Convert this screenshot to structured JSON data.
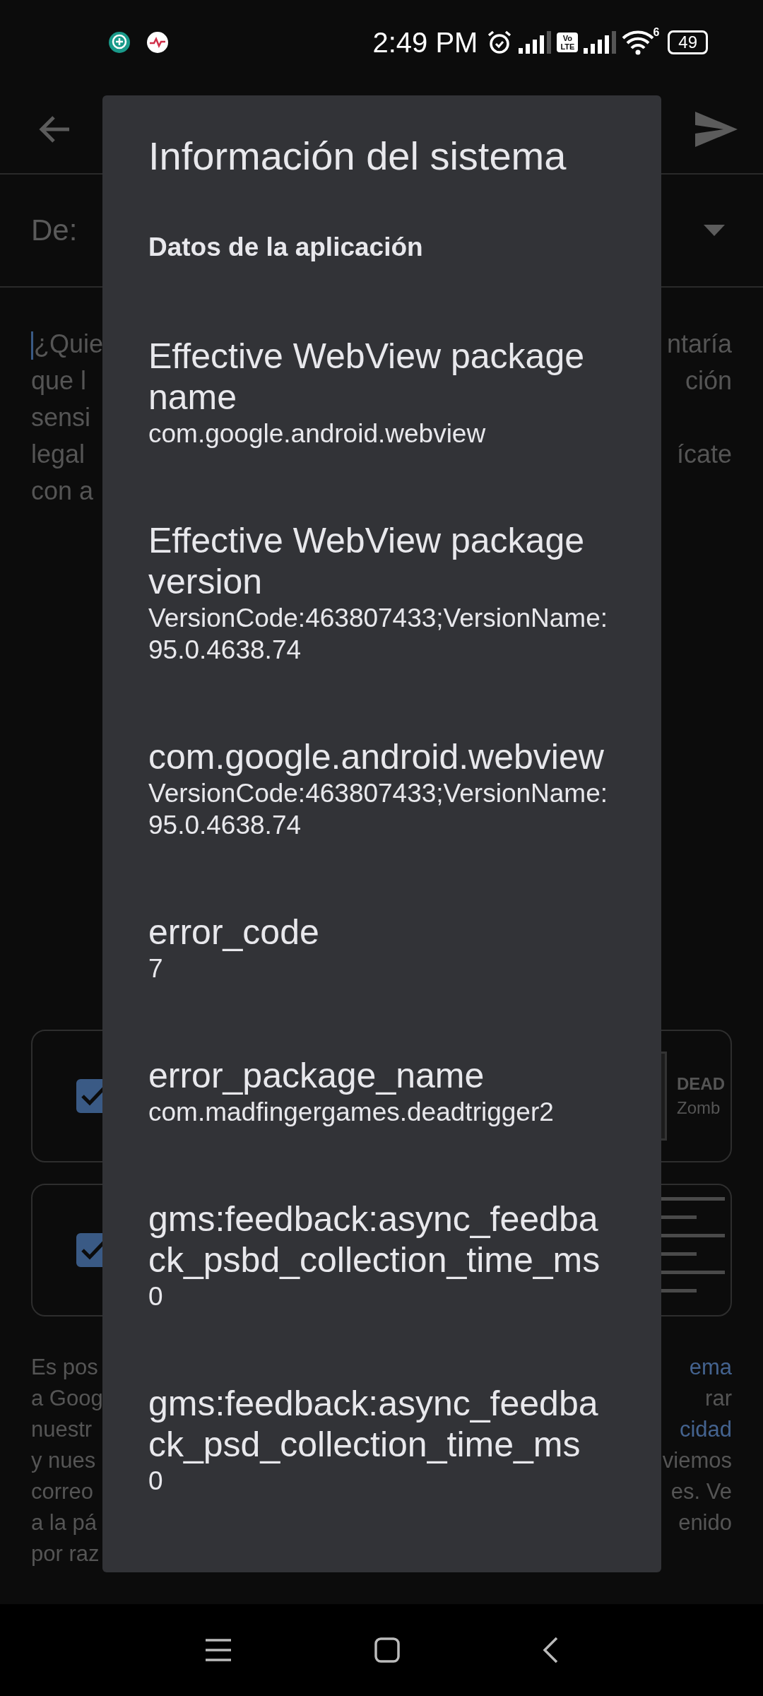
{
  "status_bar": {
    "time": "2:49 PM",
    "volte": "Vo LTE",
    "wifi_band": "6",
    "battery": "49"
  },
  "from_field": {
    "label": "De:"
  },
  "message_lines": [
    {
      "left": "¿Quie",
      "right": "ntaría"
    },
    {
      "left": "que l",
      "right": "ción"
    },
    {
      "left": "sensi"
    },
    {
      "left": "legal",
      "right": "ícate"
    },
    {
      "left": "con a"
    }
  ],
  "attachments": [
    {
      "kind": "app",
      "checked": true,
      "text_lines": [
        "DEAD",
        "Zomb"
      ]
    },
    {
      "kind": "screenshot",
      "checked": true
    }
  ],
  "footer_lines": [
    {
      "left": "Es pos",
      "right": "ema",
      "right_link": true
    },
    {
      "left": "a Goog",
      "right": "rar",
      "right_link": false
    },
    {
      "left": "nuestr",
      "right": "cidad",
      "right_link": true
    },
    {
      "left": "y nues",
      "right": "viemos",
      "right_link": false
    },
    {
      "left": "correo",
      "right": "es. Ve",
      "right_link": false
    },
    {
      "left": "a la pá",
      "right": "enido",
      "right_link": false
    },
    {
      "left": "por raz"
    }
  ],
  "dialog": {
    "title": "Información del sistema",
    "section": "Datos de la aplicación",
    "items": [
      {
        "label": "Effective WebView package name",
        "value": "com.google.android.webview"
      },
      {
        "label": "Effective WebView package version",
        "value": "VersionCode:463807433;VersionName:95.0.4638.74"
      },
      {
        "label": "com.google.android.webview",
        "value": "VersionCode:463807433;VersionName:95.0.4638.74"
      },
      {
        "label": "error_code",
        "value": "7"
      },
      {
        "label": "error_package_name",
        "value": "com.madfingergames.deadtrigger2"
      },
      {
        "label": "gms:feedback:async_feedback_psbd_collection_time_ms",
        "value": "0"
      },
      {
        "label": "gms:feedback:async_feedback_psd_collection_time_ms",
        "value": "0"
      }
    ]
  }
}
